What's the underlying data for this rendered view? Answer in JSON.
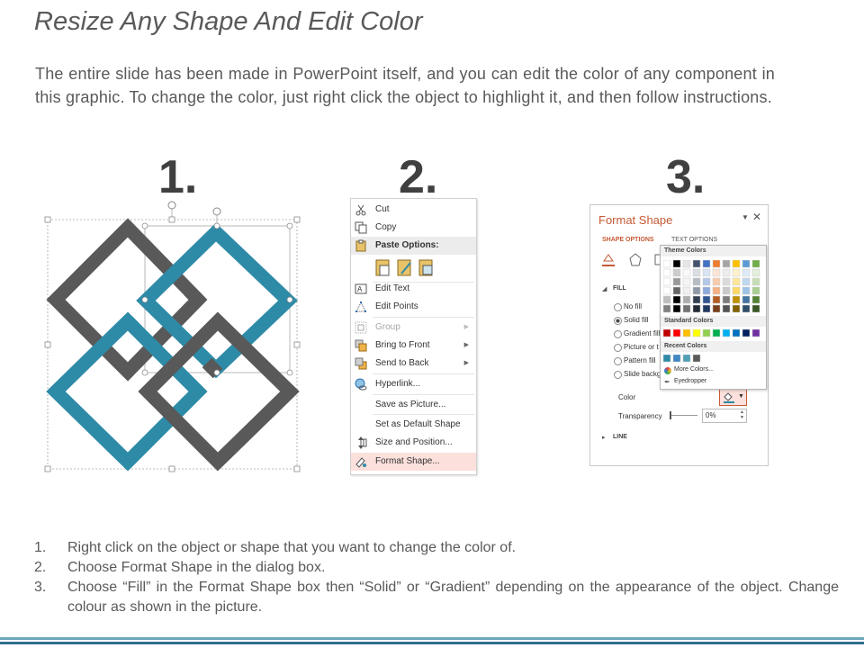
{
  "slide": {
    "title": "Resize Any Shape And Edit Color",
    "intro": "The entire slide has been made in PowerPoint itself, and you can edit the color of any component in this graphic. To change the color, just right click the object to highlight it, and then follow instructions.",
    "step_numbers": [
      "1.",
      "2.",
      "3."
    ],
    "steps": [
      {
        "n": "1.",
        "text": "Right click on the object or shape that you want to change the color of."
      },
      {
        "n": "2.",
        "text": "Choose Format Shape in the dialog box."
      },
      {
        "n": "3.",
        "text": "Choose “Fill” in the Format Shape box then “Solid” or “Gradient” depending on the appearance of the object. Change colour as shown in the picture."
      }
    ]
  },
  "colors": {
    "dark_gray": "#595959",
    "teal": "#2e8ba8",
    "footer_light": "#6da7b9",
    "footer_dark": "#2d6e8a",
    "menu_highlight": "#fbe0dc",
    "accent": "#c55a35"
  },
  "context_menu": {
    "items": [
      {
        "label": "Cut",
        "icon": "scissors-icon"
      },
      {
        "label": "Copy",
        "icon": "copy-icon"
      },
      {
        "label": "Paste Options:",
        "icon": "clipboard-icon"
      },
      {
        "label": "Edit Text",
        "icon": "edit-text-icon"
      },
      {
        "label": "Edit Points",
        "icon": "edit-points-icon"
      },
      {
        "label": "Group",
        "icon": "group-icon",
        "disabled": true
      },
      {
        "label": "Bring to Front",
        "icon": "bring-front-icon"
      },
      {
        "label": "Send to Back",
        "icon": "send-back-icon"
      },
      {
        "label": "Hyperlink...",
        "icon": "hyperlink-icon"
      },
      {
        "label": "Save as Picture...",
        "icon": ""
      },
      {
        "label": "Set as Default Shape",
        "icon": ""
      },
      {
        "label": "Size and Position...",
        "icon": "size-position-icon"
      },
      {
        "label": "Format Shape...",
        "icon": "format-shape-icon"
      }
    ]
  },
  "format_pane": {
    "title": "Format Shape",
    "tab_shape": "SHAPE OPTIONS",
    "tab_text": "TEXT OPTIONS",
    "fill_section": "FILL",
    "fill_options": [
      "No fill",
      "Solid fill",
      "Gradient fill",
      "Picture or t",
      "Pattern fill",
      "Slide backg"
    ],
    "selected_fill": "Solid fill",
    "color_label": "Color",
    "transparency_label": "Transparency",
    "transparency_value": "0%",
    "line_section": "LINE",
    "palette": {
      "theme_colors_label": "Theme Colors",
      "standard_colors_label": "Standard Colors",
      "recent_colors_label": "Recent Colors",
      "more_colors": "More Colors...",
      "eyedropper": "Eyedropper",
      "theme_row": [
        "#ffffff",
        "#000000",
        "#e7e6e6",
        "#44546a",
        "#4472c4",
        "#ed7d31",
        "#a5a5a5",
        "#ffc000",
        "#5b9bd5",
        "#70ad47"
      ],
      "standard_row": [
        "#c00000",
        "#ff0000",
        "#ffc000",
        "#ffff00",
        "#92d050",
        "#00b050",
        "#00b0f0",
        "#0070c0",
        "#002060",
        "#7030a0"
      ],
      "recent_row": [
        "#2e8ba8",
        "#3f88c5",
        "#4f9fb5",
        "#595959"
      ]
    }
  }
}
